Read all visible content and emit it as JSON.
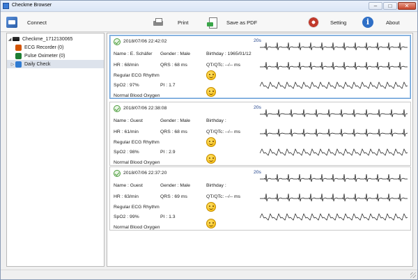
{
  "window": {
    "title": "Checkme Browser"
  },
  "toolbar": {
    "connect": {
      "label": "Connect",
      "icon": "connect-icon"
    },
    "print": {
      "label": "Print",
      "icon": "print-icon"
    },
    "save_pdf": {
      "label": "Save as PDF",
      "icon": "pdf-icon"
    },
    "setting": {
      "label": "Setting",
      "icon": "setting-icon"
    },
    "about": {
      "label": "About",
      "icon": "about-icon",
      "glyph": "i"
    }
  },
  "tree": {
    "device": "Checkme_1712130065",
    "items": [
      {
        "label": "ECG Recorder  (0)",
        "icon": "ecg-icon"
      },
      {
        "label": "Pulse Oximeter  (0)",
        "icon": "pulse-icon"
      },
      {
        "label": "Daily Check",
        "icon": "daily-icon",
        "selected": true
      }
    ]
  },
  "records": [
    {
      "datetime": "2018/07/06 22:42:02",
      "name": "Name : E. Schäfer",
      "gender": "Gender : Male",
      "birthday": "Birthday : 1965/01/12",
      "hr": "HR : 68/min",
      "qrs": "QRS : 68 ms",
      "qt": "QT/QTc: --/-- ms",
      "rhythm": "Regular ECG Rhythm",
      "spo2": "SpO2 : 97%",
      "pi": "PI : 1.7",
      "oxygen": "Normal Blood Oxygen",
      "duration": "20s"
    },
    {
      "datetime": "2018/07/06 22:38:08",
      "name": "Name : Guest",
      "gender": "Gender : Male",
      "birthday": "Birthday :",
      "hr": "HR : 61/min",
      "qrs": "QRS : 68 ms",
      "qt": "QT/QTc: --/-- ms",
      "rhythm": "Regular ECG Rhythm",
      "spo2": "SpO2 : 98%",
      "pi": "PI : 2.9",
      "oxygen": "Normal Blood Oxygen",
      "duration": "20s"
    },
    {
      "datetime": "2018/07/06 22:37:20",
      "name": "Name : Guest",
      "gender": "Gender : Male",
      "birthday": "Birthday :",
      "hr": "HR : 63/min",
      "qrs": "QRS : 69 ms",
      "qt": "QT/QTc: --/-- ms",
      "rhythm": "Regular ECG Rhythm",
      "spo2": "SpO2 : 99%",
      "pi": "PI : 1.3",
      "oxygen": "Normal Blood Oxygen",
      "duration": "20s"
    }
  ]
}
